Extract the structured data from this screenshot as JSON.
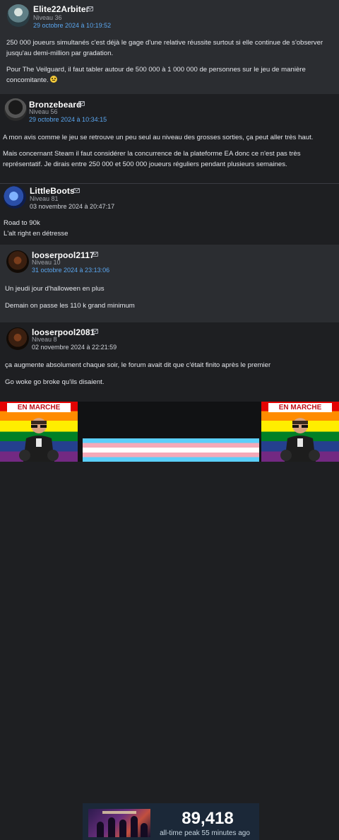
{
  "posts": [
    {
      "username": "Elite22Arbiter",
      "level": "Niveau 36",
      "date": "29 octobre 2024 à 10:19:52",
      "paragraphs": [
        "250 000 joueurs simultanés c'est déjà le gage d'une relative réussite surtout si elle continue de s'observer jusqu'au demi-million par gradation.",
        "Pour The Veilguard, il faut tabler autour de 500 000 à 1 000 000 de personnes sur le jeu de manière concomitante."
      ]
    },
    {
      "username": "Bronzebeard",
      "level": "Niveau 56",
      "date": "29 octobre 2024 à 10:34:15",
      "paragraphs": [
        "A mon avis comme le jeu se retrouve un peu seul au niveau des grosses sorties, ça peut aller très haut.",
        "Mais concernant Steam il faut considérer la concurrence de la plateforme EA donc ce n'est pas très représentatif. Je dirais entre 250 000 et 500 000 joueurs réguliers pendant plusieurs semaines."
      ]
    },
    {
      "username": "LittleBoots",
      "level": "Niveau 81",
      "date": "03 novembre 2024 à 20:47:17",
      "paragraphs": [
        "Road to 90k",
        "L'alt right en détresse"
      ]
    },
    {
      "username": "looserpool2117",
      "level": "Niveau 10",
      "date": "31 octobre 2024 à 23:13:06",
      "paragraphs": [
        "Un jeudi jour d'halloween en plus",
        "Demain on passe les 110 k grand minimum"
      ]
    },
    {
      "username": "looserpool2081",
      "level": "Niveau 8",
      "date": "02 novembre 2024 à 22:21:59",
      "paragraphs": [
        "ça augmente absolument chaque soir, le forum avait dit que c'était finito après le premier",
        "Go woke go broke qu'ils disaient."
      ]
    }
  ],
  "banner": {
    "left_tag": "EN MARCHE",
    "right_tag": "EN MARCHE",
    "player_count": "89,418",
    "peak_label": "all-time peak 55 minutes ago"
  },
  "icons": {
    "mail": "envelope-icon",
    "emoji": "smiley-emoji-icon"
  },
  "colors": {
    "background": "#1e1f22",
    "quoted_background": "#2b2d31",
    "date_link": "#5aa6ef",
    "steam_panel": "#1b2838"
  }
}
